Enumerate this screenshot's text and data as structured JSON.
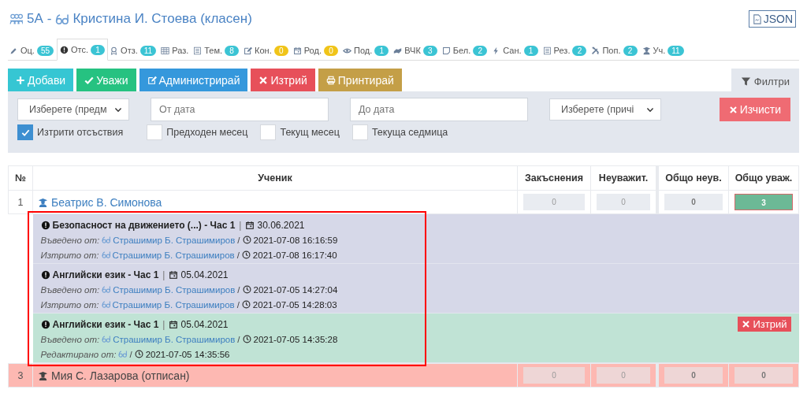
{
  "header": {
    "class_name": "5A",
    "dash": "-",
    "teacher": "Кристина И. Стоева (класен)",
    "json_button": "JSON"
  },
  "tabs": [
    {
      "label": "Оц.",
      "count": "55",
      "color": "#3bc4d4",
      "selected": false
    },
    {
      "label": "Отс.",
      "count": "1",
      "color": "#3bc4d4",
      "selected": true
    },
    {
      "label": "Отз.",
      "count": "11",
      "color": "#3bc4d4",
      "selected": false
    },
    {
      "label": "Раз.",
      "selected": false
    },
    {
      "label": "Тем.",
      "count": "8",
      "color": "#3bc4d4",
      "selected": false
    },
    {
      "label": "Кон.",
      "count": "0",
      "color": "#f0c419",
      "selected": false
    },
    {
      "label": "Род.",
      "count": "0",
      "color": "#f0c419",
      "selected": false
    },
    {
      "label": "Под.",
      "count": "1",
      "color": "#3bc4d4",
      "selected": false
    },
    {
      "label": "ВЧК",
      "count": "3",
      "color": "#3bc4d4",
      "selected": false
    },
    {
      "label": "Бел.",
      "count": "2",
      "color": "#3bc4d4",
      "selected": false
    },
    {
      "label": "Сан.",
      "count": "1",
      "color": "#3bc4d4",
      "selected": false
    },
    {
      "label": "Рез.",
      "count": "2",
      "color": "#3bc4d4",
      "selected": false
    },
    {
      "label": "Поп.",
      "count": "2",
      "color": "#3bc4d4",
      "selected": false
    },
    {
      "label": "Уч.",
      "count": "11",
      "color": "#3bc4d4",
      "selected": false
    }
  ],
  "actions": [
    {
      "label": "Добави",
      "color": "#36c6d3"
    },
    {
      "label": "Уважи",
      "color": "#26c281"
    },
    {
      "label": "Администрирай",
      "color": "#3598dc"
    },
    {
      "label": "Изтрий",
      "color": "#e7505a"
    },
    {
      "label": "Принтирай",
      "color": "#c49f47"
    }
  ],
  "filter_toggle": {
    "label": "Филтри",
    "selected": true
  },
  "filters": {
    "subject_select": "Изберете (предм",
    "from_date": {
      "placeholder": "От дата"
    },
    "to_date": {
      "placeholder": "До дата"
    },
    "reason_select": "Изберете (причі",
    "clear_button": "Изчисти",
    "checkboxes": [
      {
        "label": "Изтрити отсъствия",
        "checked": true
      },
      {
        "label": "Предходен месец",
        "checked": false
      },
      {
        "label": "Текущ месец",
        "checked": false
      },
      {
        "label": "Текуща седмица",
        "checked": false
      }
    ]
  },
  "table": {
    "columns": [
      "№",
      "Ученик",
      "Закъснения",
      "Неуважит.",
      "Общо неув.",
      "Общо уваж."
    ],
    "rows": [
      {
        "kind": "student",
        "number": "1",
        "name": "Беатрис В. Симонова",
        "withdrawn": false,
        "values": [
          {
            "text": "0",
            "highlight": false
          },
          {
            "text": "0",
            "highlight": false
          },
          {
            "text": "0",
            "highlight": false
          },
          {
            "text": "3",
            "highlight": true
          }
        ]
      },
      {
        "kind": "details",
        "entries": [
          {
            "subject": "Безопасност на движението (...) - Час 1",
            "sep": "|",
            "date": "30.06.2021",
            "deleted": true,
            "lines": [
              {
                "label": "Въведено от:",
                "user": "Страшимир Б. Страшимиров",
                "sep": "/",
                "time": "2021-07-08 16:16:59"
              },
              {
                "label": "Изтрито от:",
                "user": "Страшимир Б. Страшимиров",
                "sep": "/",
                "time": "2021-07-08 16:17:40"
              }
            ]
          },
          {
            "subject": "Английски език - Час 1",
            "sep": "|",
            "date": "05.04.2021",
            "deleted": true,
            "lines": [
              {
                "label": "Въведено от:",
                "user": "Страшимир Б. Страшимиров",
                "sep": "/",
                "time": "2021-07-05 14:27:04"
              },
              {
                "label": "Изтрито от:",
                "user": "Страшимир Б. Страшимиров",
                "sep": "/",
                "time": "2021-07-05 14:28:03"
              }
            ]
          },
          {
            "subject": "Английски език - Час 1",
            "sep": "|",
            "date": "05.04.2021",
            "deleted": false,
            "delete_button": "Изтрий",
            "lines": [
              {
                "label": "Въведено от:",
                "user": "Страшимир Б. Страшимиров",
                "sep": "/",
                "time": "2021-07-05 14:35:28"
              },
              {
                "label": "Редактирано от:",
                "sep": "/",
                "time": "2021-07-05 14:35:56"
              }
            ]
          }
        ]
      },
      {
        "kind": "student",
        "number": "3",
        "name": "Мия С. Лазарова (отписан)",
        "withdrawn": true,
        "values": [
          {
            "text": "0",
            "highlight": false
          },
          {
            "text": "0",
            "highlight": false
          },
          {
            "text": "0",
            "highlight": false
          },
          {
            "text": "0",
            "highlight": false
          }
        ]
      }
    ]
  }
}
